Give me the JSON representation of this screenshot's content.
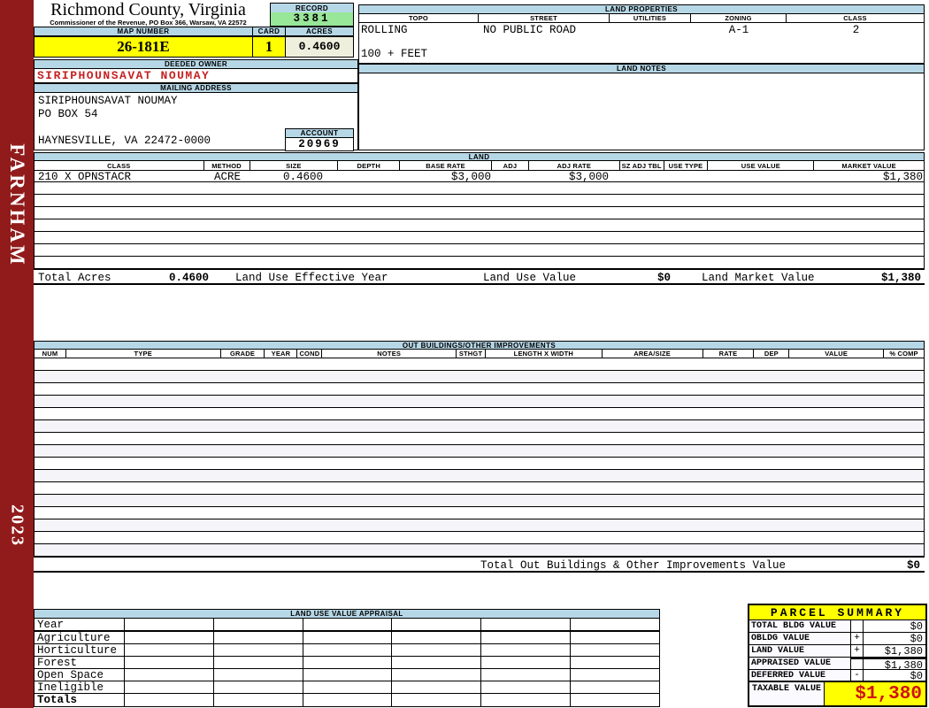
{
  "county": {
    "title": "Richmond County, Virginia",
    "subtitle": "Commissioner of the Revenue, PO Box 366, Warsaw, VA 22572"
  },
  "sidebar": {
    "district": "FARNHAM",
    "year": "2023"
  },
  "record": {
    "label": "RECORD",
    "value": "3381"
  },
  "map": {
    "label": "MAP NUMBER",
    "value": "26-181E"
  },
  "card": {
    "label": "CARD",
    "value": "1"
  },
  "acres": {
    "label": "ACRES",
    "value": "0.4600"
  },
  "owner": {
    "label": "DEEDED OWNER",
    "name": "SIRIPHOUNSAVAT NOUMAY"
  },
  "mailing": {
    "label": "MAILING ADDRESS",
    "line1": "SIRIPHOUNSAVAT NOUMAY",
    "line2": "PO BOX 54",
    "line3": "HAYNESVILLE, VA 22472-0000"
  },
  "account": {
    "label": "ACCOUNT",
    "value": "20969"
  },
  "land_properties": {
    "title": "LAND PROPERTIES",
    "headers": [
      "TOPO",
      "STREET",
      "UTILITIES",
      "ZONING",
      "CLASS"
    ],
    "values": {
      "topo": "ROLLING",
      "street": "NO PUBLIC ROAD",
      "utilities": "",
      "zoning": "A-1",
      "class": "2"
    },
    "frontage": "100 + FEET"
  },
  "land_notes": {
    "title": "LAND NOTES",
    "text": ""
  },
  "land": {
    "title": "LAND",
    "headers": [
      "CLASS",
      "METHOD",
      "SIZE",
      "DEPTH",
      "BASE RATE",
      "ADJ",
      "ADJ RATE",
      "SZ ADJ TBL",
      "USE TYPE",
      "USE VALUE",
      "MARKET VALUE"
    ],
    "rows": [
      [
        "210 X OPNSTACR",
        "ACRE",
        "0.4600",
        "",
        "$3,000",
        "",
        "$3,000",
        "",
        "",
        "",
        "$1,380"
      ]
    ],
    "empty_row_count": 7,
    "totals": {
      "total_acres_label": "Total Acres",
      "total_acres": "0.4600",
      "effective_year_label": "Land Use Effective Year",
      "use_value_label": "Land Use Value",
      "use_value": "$0",
      "market_value_label": "Land Market Value",
      "market_value": "$1,380"
    }
  },
  "out_buildings": {
    "title": "OUT BUILDINGS/OTHER IMPROVEMENTS",
    "headers": [
      "NUM",
      "TYPE",
      "GRADE",
      "YEAR",
      "COND",
      "NOTES",
      "STHGT",
      "LENGTH X WIDTH",
      "AREA/SIZE",
      "RATE",
      "DEP",
      "VALUE",
      "% COMP"
    ],
    "empty_row_count": 16,
    "total_label": "Total Out Buildings & Other Improvements Value",
    "total_value": "$0"
  },
  "land_use_appraisal": {
    "title": "LAND USE VALUE APPRAISAL",
    "row_labels": [
      "Year",
      "Agriculture",
      "Horticulture",
      "Forest",
      "Open Space",
      "Ineligible",
      "Totals"
    ],
    "column_count": 6
  },
  "parcel_summary": {
    "title": "PARCEL SUMMARY",
    "rows": [
      {
        "label": "TOTAL BLDG VALUE",
        "op": "",
        "value": "$0"
      },
      {
        "label": "OBLDG VALUE",
        "op": "+",
        "value": "$0"
      },
      {
        "label": "LAND VALUE",
        "op": "+",
        "value": "$1,380"
      },
      {
        "label": "APPRAISED VALUE",
        "op": "",
        "value": "$1,380"
      },
      {
        "label": "DEFERRED VALUE",
        "op": "-",
        "value": "$0"
      }
    ],
    "taxable": {
      "label": "TAXABLE VALUE",
      "value": "$1,380"
    }
  },
  "colors": {
    "maroon": "#911B1B",
    "label_blue": "#B6D7E6",
    "record_green": "#98E698",
    "highlight_yellow": "#FFFF00",
    "acres_cream": "#EFEFDE",
    "owner_red": "#C52222",
    "taxable_red": "#D01111"
  }
}
